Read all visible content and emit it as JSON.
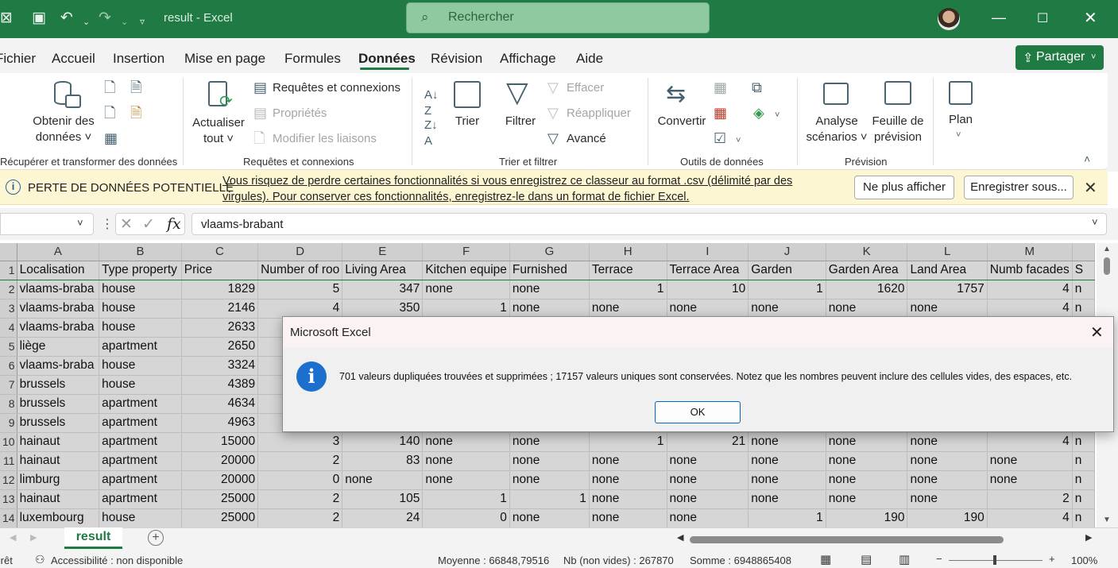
{
  "titlebar": {
    "app_icon": "excel-logo-icon",
    "doc_title": "result  -  Excel",
    "search_placeholder": "Rechercher",
    "accent": "#1f7a43"
  },
  "menu": {
    "items": [
      "Fichier",
      "Accueil",
      "Insertion",
      "Mise en page",
      "Formules",
      "Données",
      "Révision",
      "Affichage",
      "Aide"
    ],
    "active": "Données",
    "share_label": "Partager"
  },
  "ribbon": {
    "get_data": "Obtenir des\ndonnées ˅",
    "refresh_all": "Actualiser\ntout ˅",
    "queries_connections": "Requêtes et connexions",
    "properties": "Propriétés",
    "edit_links": "Modifier les liaisons",
    "sort": "Trier",
    "filter": "Filtrer",
    "clear": "Effacer",
    "reapply": "Réappliquer",
    "advanced": "Avancé",
    "convert": "Convertir",
    "whatif": "Analyse\nscénarios ˅",
    "forecast_sheet": "Feuille de\nprévision",
    "outline": "Plan",
    "groups": {
      "get_transform": "Récupérer et transformer des données",
      "queries": "Requêtes et connexions",
      "sort_filter": "Trier et filtrer",
      "data_tools": "Outils de données",
      "forecast": "Prévision"
    }
  },
  "warning": {
    "title": "PERTE DE DONNÉES POTENTIELLE",
    "message": "Vous risquez de perdre certaines fonctionnalités si vous enregistrez ce classeur au format .csv (délimité par des virgules). Pour conserver ces fonctionnalités, enregistrez-le dans un format de fichier Excel.",
    "dont_show": "Ne plus afficher",
    "save_as": "Enregistrer sous..."
  },
  "formula_bar": {
    "fx": "fx",
    "value": "vlaams-brabant"
  },
  "grid": {
    "columns": [
      "A",
      "B",
      "C",
      "D",
      "E",
      "F",
      "G",
      "H",
      "I",
      "J",
      "K",
      "L",
      "M"
    ],
    "rows": [
      {
        "n": "1",
        "cells": [
          "Localisation",
          "Type property",
          "Price",
          "Number of roo",
          "Living Area",
          "Kitchen equipe",
          "Furnished",
          "Terrace",
          "Terrace Area",
          "Garden",
          "Garden Area",
          "Land Area",
          "Numb facades",
          "S"
        ]
      },
      {
        "n": "2",
        "cells": [
          "vlaams-braba",
          "house",
          "1829",
          "5",
          "347",
          "none",
          "none",
          "1",
          "10",
          "1",
          "1620",
          "1757",
          "4",
          "n"
        ]
      },
      {
        "n": "3",
        "cells": [
          "vlaams-braba",
          "house",
          "2146",
          "4",
          "350",
          "1",
          "none",
          "none",
          "none",
          "none",
          "none",
          "none",
          "4",
          "n"
        ]
      },
      {
        "n": "4",
        "cells": [
          "vlaams-braba",
          "house",
          "2633",
          "",
          "",
          "",
          "",
          "",
          "",
          "",
          "",
          "",
          "",
          ""
        ]
      },
      {
        "n": "5",
        "cells": [
          "liège",
          "apartment",
          "2650",
          "",
          "",
          "",
          "",
          "",
          "",
          "",
          "",
          "",
          "",
          ""
        ]
      },
      {
        "n": "6",
        "cells": [
          "vlaams-braba",
          "house",
          "3324",
          "",
          "",
          "",
          "",
          "",
          "",
          "",
          "",
          "",
          "",
          ""
        ]
      },
      {
        "n": "7",
        "cells": [
          "brussels",
          "house",
          "4389",
          "",
          "",
          "",
          "",
          "",
          "",
          "",
          "",
          "",
          "",
          ""
        ]
      },
      {
        "n": "8",
        "cells": [
          "brussels",
          "apartment",
          "4634",
          "",
          "",
          "",
          "",
          "",
          "",
          "",
          "",
          "",
          "",
          ""
        ]
      },
      {
        "n": "9",
        "cells": [
          "brussels",
          "apartment",
          "4963",
          "",
          "",
          "",
          "",
          "",
          "",
          "",
          "",
          "",
          "",
          ""
        ]
      },
      {
        "n": "10",
        "cells": [
          "hainaut",
          "apartment",
          "15000",
          "3",
          "140",
          "none",
          "none",
          "1",
          "21",
          "none",
          "none",
          "none",
          "4",
          "n"
        ]
      },
      {
        "n": "11",
        "cells": [
          "hainaut",
          "apartment",
          "20000",
          "2",
          "83",
          "none",
          "none",
          "none",
          "none",
          "none",
          "none",
          "none",
          "none",
          "n"
        ]
      },
      {
        "n": "12",
        "cells": [
          "limburg",
          "apartment",
          "20000",
          "0",
          "none",
          "none",
          "none",
          "none",
          "none",
          "none",
          "none",
          "none",
          "none",
          "n"
        ]
      },
      {
        "n": "13",
        "cells": [
          "hainaut",
          "apartment",
          "25000",
          "2",
          "105",
          "1",
          "1",
          "none",
          "none",
          "none",
          "none",
          "none",
          "2",
          "n"
        ]
      },
      {
        "n": "14",
        "cells": [
          "luxembourg",
          "house",
          "25000",
          "2",
          "24",
          "0",
          "none",
          "none",
          "none",
          "1",
          "190",
          "190",
          "4",
          "n"
        ]
      }
    ]
  },
  "sheet_tab": "result",
  "status": {
    "ready": "Prêt",
    "accessibility": "Accessibilité : non disponible",
    "average": "Moyenne : 66848,79516",
    "count": "Nb (non vides) : 267870",
    "sum": "Somme : 6948865408",
    "zoom": "100%"
  },
  "dialog": {
    "title": "Microsoft Excel",
    "message": "701 valeurs dupliquées trouvées et supprimées ; 17157 valeurs uniques sont conservées. Notez que les nombres peuvent inclure des cellules vides, des espaces, etc.",
    "ok": "OK"
  }
}
